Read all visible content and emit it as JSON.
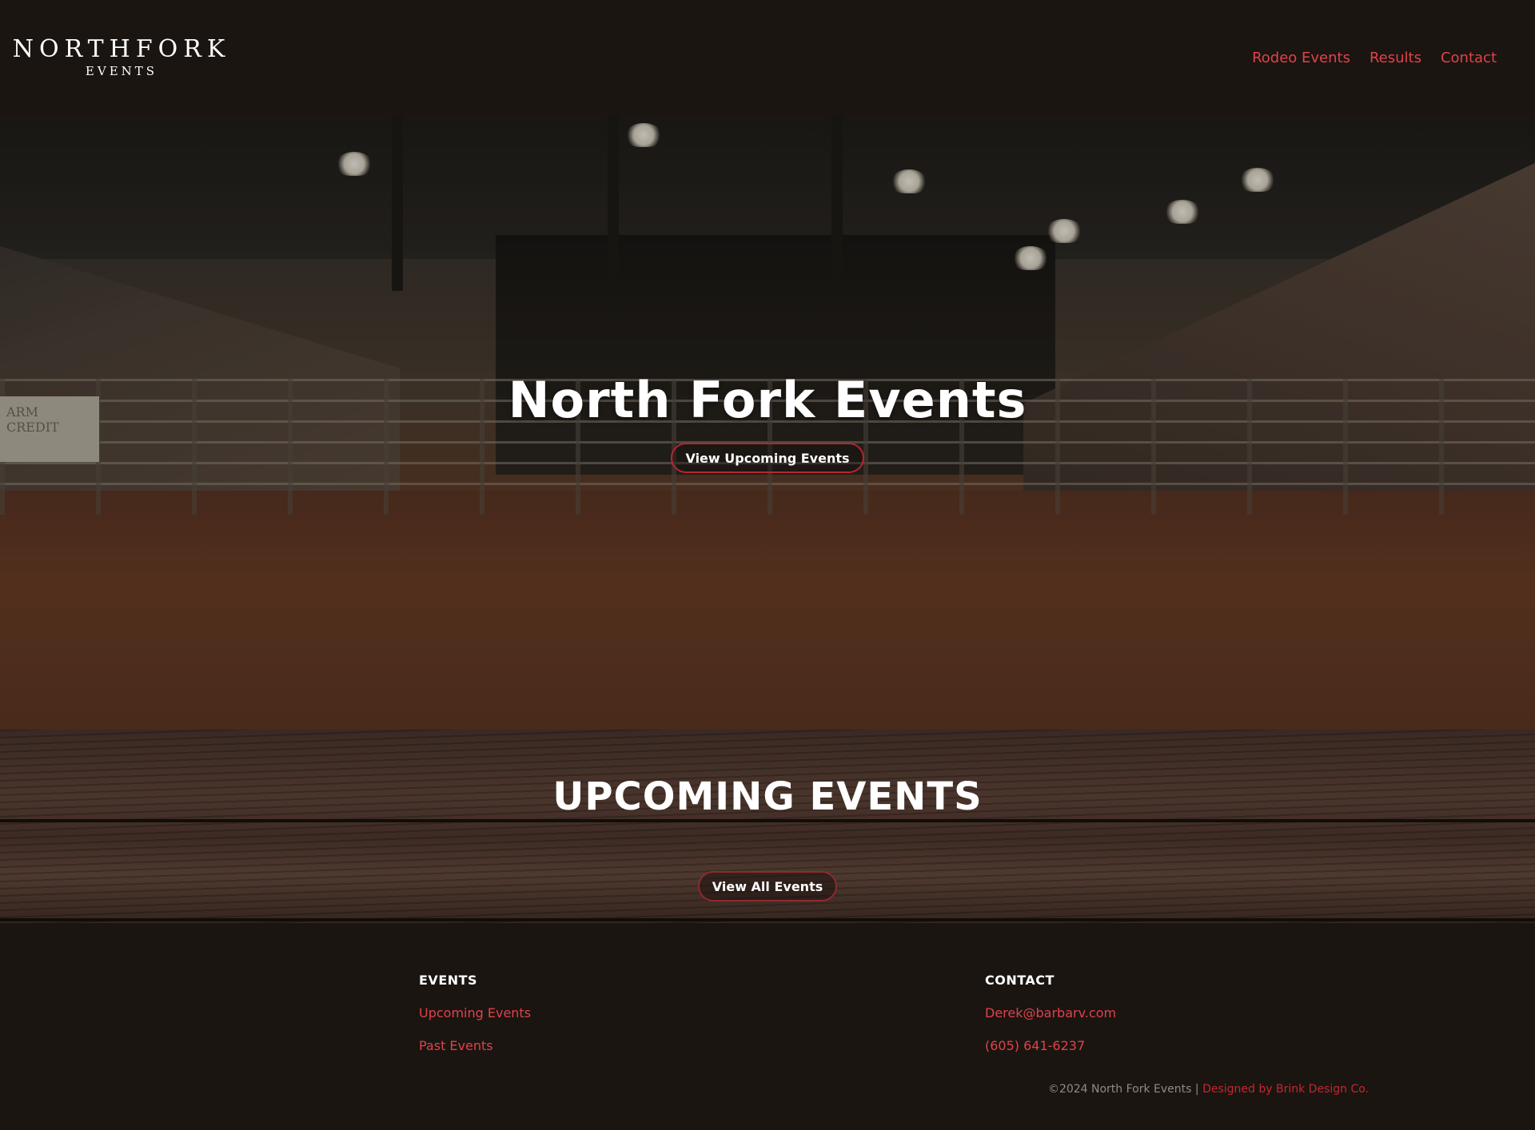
{
  "header": {
    "logo_top": "NORTHFORK",
    "logo_bottom": "EVENTS",
    "nav": [
      {
        "label": "Rodeo Events"
      },
      {
        "label": "Results"
      },
      {
        "label": "Contact"
      }
    ]
  },
  "hero": {
    "title": "North Fork Events",
    "button_label": "View Upcoming Events",
    "banner_text": "ARM CREDIT"
  },
  "upcoming": {
    "title": "UPCOMING EVENTS",
    "button_label": "View All Events"
  },
  "footer": {
    "events": {
      "heading": "EVENTS",
      "links": [
        {
          "label": "Upcoming Events"
        },
        {
          "label": "Past Events"
        }
      ]
    },
    "contact": {
      "heading": "CONTACT",
      "email": "Derek@barbarv.com",
      "phone": "(605) 641-6237"
    },
    "copyright": "©2024 North Fork Events | ",
    "credit": "Designed by Brink Design Co."
  },
  "colors": {
    "background": "#1a1511",
    "accent": "#e0424a",
    "button_border": "#b5262f"
  }
}
